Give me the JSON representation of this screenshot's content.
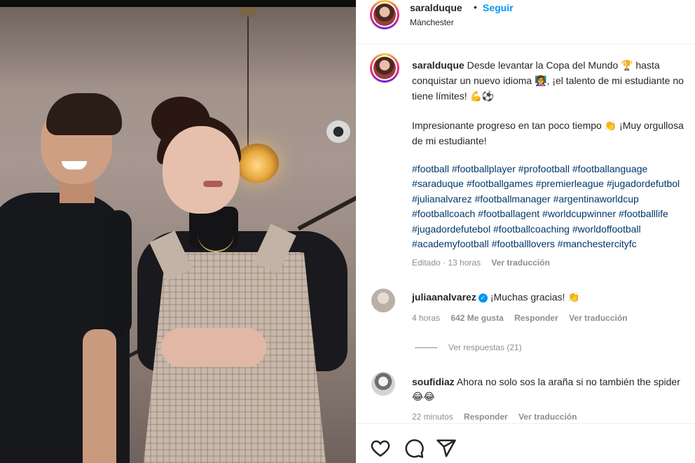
{
  "post": {
    "username": "saralduque",
    "follow_label": "Seguir",
    "separator": "•",
    "location": "Mánchester",
    "caption": {
      "line1": "Desde levantar la Copa del Mundo 🏆 hasta",
      "line2": "conquistar un nuevo idioma 👩‍🏫, ¡el talento de mi estudiante no",
      "line3": "tiene límites! 💪⚽",
      "line4": "Impresionante progreso en tan poco tiempo 👏 ¡Muy orgullosa",
      "line5": "de mi estudiante!"
    },
    "hashtags": [
      "#football #footballplayer #profootball #footballanguage",
      "#saraduque #footballgames #premierleague #jugadordefutbol",
      "#julianalvarez #footballmanager #argentinaworldcup",
      "#footballcoach #footballagent #worldcupwinner #footballlife",
      "#jugadordefutebol #footballcoaching #worldoffootball",
      "#academyfootball #footballlovers #manchestercityfc"
    ],
    "edited": "Editado · 13 horas",
    "see_translation": "Ver traducción"
  },
  "comments": [
    {
      "username": "juliaanalvarez",
      "verified_mark": "✓",
      "text": "¡Muchas gracias! 👏",
      "time": "4 horas",
      "likes": "642 Me gusta",
      "reply": "Responder",
      "translate": "Ver traducción",
      "view_replies": "Ver respuestas (21)"
    },
    {
      "username": "soufidiaz",
      "text": "Ahora no solo sos la araña si no también the spider",
      "text_line2": "😂😂",
      "time": "22 minutos",
      "reply": "Responder",
      "translate": "Ver traducción"
    }
  ],
  "actions": {
    "like_icon": "heart-icon",
    "comment_icon": "comment-icon",
    "share_icon": "share-icon"
  },
  "colors": {
    "link_blue": "#0095f6",
    "hashtag_blue": "#00376b",
    "muted": "#8e8e8e",
    "text": "#262626"
  }
}
